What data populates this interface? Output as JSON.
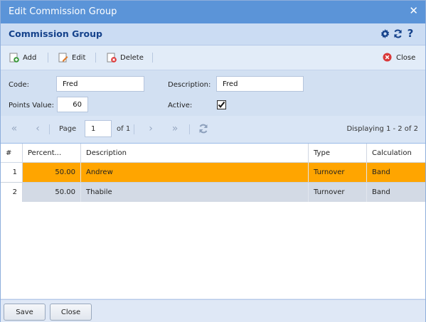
{
  "window": {
    "title": "Edit Commission Group",
    "close_glyph": "✕"
  },
  "panel": {
    "title": "Commission Group",
    "tools": [
      "gear-icon",
      "refresh-icon",
      "help-icon"
    ]
  },
  "toolbar": {
    "add_label": "Add",
    "edit_label": "Edit",
    "delete_label": "Delete",
    "close_label": "Close"
  },
  "form": {
    "code_label": "Code:",
    "code_value": "Fred",
    "description_label": "Description:",
    "description_value": "Fred",
    "points_label": "Points Value:",
    "points_value": "60",
    "active_label": "Active:",
    "active_checked": true
  },
  "pager": {
    "page_label": "Page",
    "page_value": "1",
    "of_label": "of 1",
    "display_text": "Displaying 1 - 2 of 2"
  },
  "grid": {
    "columns": [
      "#",
      "Percent...",
      "Description",
      "Type",
      "Calculation"
    ],
    "rows": [
      {
        "num": "1",
        "percent": "50.00",
        "description": "Andrew",
        "type": "Turnover",
        "calculation": "Band",
        "selected": true
      },
      {
        "num": "2",
        "percent": "50.00",
        "description": "Thabile",
        "type": "Turnover",
        "calculation": "Band",
        "selected": false
      }
    ]
  },
  "footer": {
    "save_label": "Save",
    "close_label": "Close"
  },
  "colors": {
    "title_bar": "#5b94d8",
    "selected_row": "#ffa500",
    "panel_title": "#15428b"
  }
}
